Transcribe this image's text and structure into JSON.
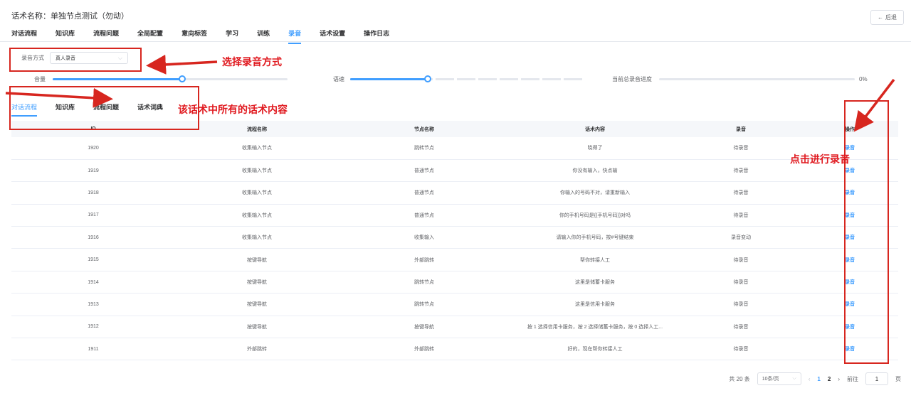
{
  "header": {
    "title": "话术名称：单独节点测试（勿动）",
    "back_icon": "←",
    "back_label": "后退"
  },
  "main_tabs": [
    "对话流程",
    "知识库",
    "流程问题",
    "全局配置",
    "意向标签",
    "学习",
    "训练",
    "录音",
    "话术设置",
    "操作日志"
  ],
  "recording": {
    "mode_label": "录音方式",
    "mode_value": "真人录音",
    "volume_label": "音量",
    "volume_fraction": 0.55,
    "speed_label": "语速",
    "speed_fraction": 0.33,
    "progress_label": "当前总录音进度",
    "progress_value": "0%"
  },
  "sub_tabs": [
    "对话流程",
    "知识库",
    "流程问题",
    "话术词典"
  ],
  "table": {
    "headers": [
      "ID",
      "流程名称",
      "节点名称",
      "话术内容",
      "录音",
      "操作"
    ],
    "rows": [
      [
        "1920",
        "收集输入节点",
        "跳转节点",
        "晓得了",
        "待录音",
        "录音"
      ],
      [
        "1919",
        "收集输入节点",
        "普通节点",
        "你没有输入，快点输",
        "待录音",
        "录音"
      ],
      [
        "1918",
        "收集输入节点",
        "普通节点",
        "你输入的号码不对，请重新输入",
        "待录音",
        "录音"
      ],
      [
        "1917",
        "收集输入节点",
        "普通节点",
        "你的手机号码是{{手机号码}}对吗",
        "待录音",
        "录音"
      ],
      [
        "1916",
        "收集输入节点",
        "收集输入",
        "请输入你的手机号码，按#号键结束",
        "录音变动",
        "录音"
      ],
      [
        "1915",
        "按键导航",
        "外部跳转",
        "帮你转接人工",
        "待录音",
        "录音"
      ],
      [
        "1914",
        "按键导航",
        "跳转节点",
        "这里是储蓄卡服务",
        "待录音",
        "录音"
      ],
      [
        "1913",
        "按键导航",
        "跳转节点",
        "这里是信用卡服务",
        "待录音",
        "录音"
      ],
      [
        "1912",
        "按键导航",
        "按键导航",
        "按 1 选择信用卡服务，按 2 选择储蓄卡服务，按 0 选择人工...",
        "待录音",
        "录音"
      ],
      [
        "1911",
        "外部跳转",
        "外部跳转",
        "好的，现在帮你转接人工",
        "待录音",
        "录音"
      ]
    ]
  },
  "pagination": {
    "total": "共 20 条",
    "page_size": "10条/页",
    "prev_icon": "‹",
    "pages": [
      "1",
      "2"
    ],
    "next_icon": "›",
    "goto_label": "前往",
    "goto_value": "1",
    "goto_suffix": "页"
  },
  "annotations": {
    "select_mode": "选择录音方式",
    "all_content": "该话术中所有的话术内容",
    "click_record": "点击进行录音",
    "color": "#e0191f"
  }
}
